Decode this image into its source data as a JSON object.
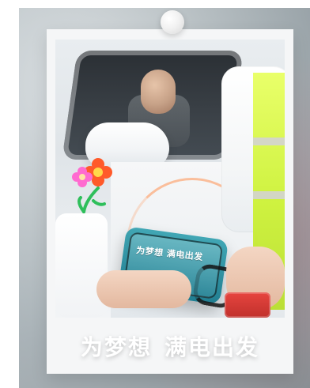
{
  "card": {
    "caption_left": "为梦想",
    "caption_right": "满电出发"
  },
  "pouch": {
    "text": "为梦想 满电出发"
  },
  "colors": {
    "vest": "#d9ff3b",
    "pouch": "#1f8d9f",
    "red_box": "#d73a35",
    "flower_petal": "#ff5a2a",
    "flower_center": "#ffd84a",
    "stem": "#2fbf5b"
  }
}
